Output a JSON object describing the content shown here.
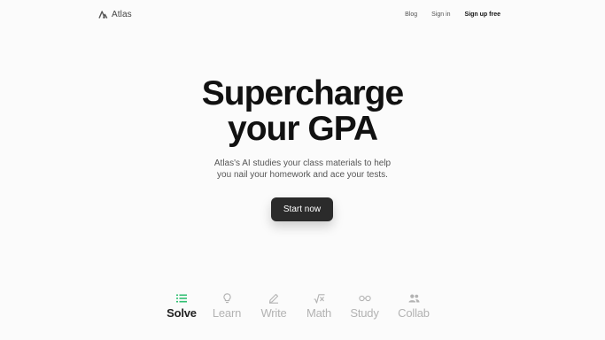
{
  "header": {
    "logo_text": "Atlas",
    "nav": {
      "blog": "Blog",
      "signin": "Sign in",
      "signup": "Sign up free"
    }
  },
  "hero": {
    "title_line1": "Supercharge",
    "title_line2": "your GPA",
    "subtitle_line1": "Atlas's AI studies your class materials to help",
    "subtitle_line2": "you nail your homework and ace your tests.",
    "cta_label": "Start now"
  },
  "tabs": [
    {
      "label": "Solve",
      "icon": "list-icon",
      "active": true
    },
    {
      "label": "Learn",
      "icon": "lightbulb-icon",
      "active": false
    },
    {
      "label": "Write",
      "icon": "pencil-icon",
      "active": false
    },
    {
      "label": "Math",
      "icon": "sqrt-icon",
      "active": false
    },
    {
      "label": "Study",
      "icon": "glasses-icon",
      "active": false
    },
    {
      "label": "Collab",
      "icon": "people-icon",
      "active": false
    }
  ],
  "colors": {
    "accent": "#2fbf71",
    "cta_bg": "#2b2b2b",
    "inactive": "#b3b3b3"
  }
}
